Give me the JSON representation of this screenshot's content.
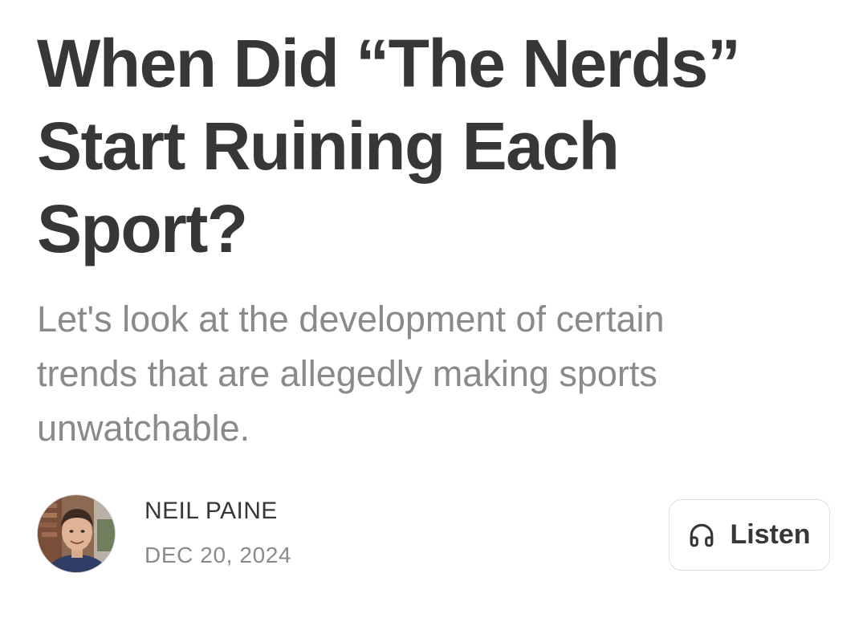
{
  "article": {
    "title": "When Did “The Nerds” Start Ruining Each Sport?",
    "subtitle": "Let's look at the development of certain trends that are allegedly making sports unwatchable."
  },
  "byline": {
    "author": "NEIL PAINE",
    "date": "DEC 20, 2024"
  },
  "listen": {
    "label": "Listen",
    "icon": "headphones-icon"
  },
  "colors": {
    "text": "#363737",
    "muted": "#8a8a8a",
    "border": "#dedede"
  }
}
